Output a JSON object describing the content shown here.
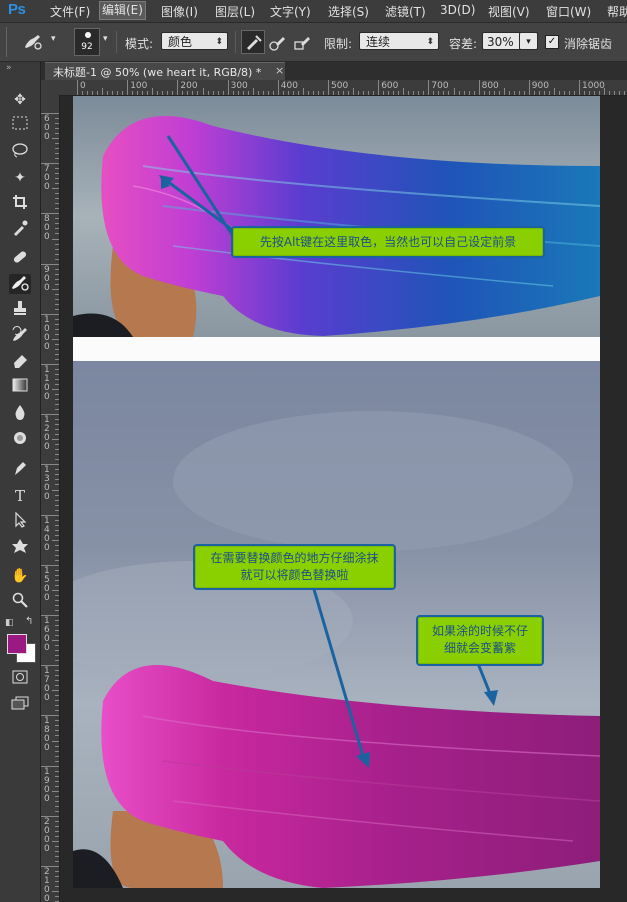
{
  "app": {
    "logo": "Ps"
  },
  "menu": [
    "文件(F)",
    "编辑(E)",
    "图像(I)",
    "图层(L)",
    "文字(Y)",
    "选择(S)",
    "滤镜(T)",
    "3D(D)",
    "视图(V)",
    "窗口(W)",
    "帮助"
  ],
  "options": {
    "brush_size": "92",
    "mode_label": "模式:",
    "mode_value": "颜色",
    "limit_label": "限制:",
    "limit_value": "连续",
    "tolerance_label": "容差:",
    "tolerance_value": "30%",
    "antialias_label": "消除锯齿",
    "antialias_checked": true
  },
  "document_tab": {
    "title": "未标题-1 @ 50% (we heart it, RGB/8) *",
    "close": "×"
  },
  "ruler": {
    "h_labels": [
      "0",
      "100",
      "200",
      "300",
      "400",
      "500",
      "600",
      "700",
      "800",
      "900",
      "1000"
    ],
    "v_labels": [
      "6 0 0",
      "7 0 0",
      "8 0 0",
      "9 0 0",
      "1 0 0 0",
      "1 1 0 0",
      "1 2 0 0",
      "1 3 0 0",
      "1 4 0 0",
      "1 5 0 0",
      "1 6 0 0",
      "1 7 0 0",
      "1 8 0 0",
      "1 9 0 0",
      "2 0 0 0",
      "2 1 0 0"
    ]
  },
  "colors": {
    "foreground": "#9b1a82",
    "background": "#ffffff",
    "callout_fill": "#8ad000",
    "callout_border": "#1b63a0",
    "arrow": "#1b63a0"
  },
  "annotations": {
    "callout1": "先按Alt键在这里取色，当然也可以自己设定前景",
    "callout2_line1": "在需要替换颜色的地方仔细涂抹",
    "callout2_line2": "就可以将颜色替换啦",
    "callout3_line1": "如果涂的时候不仔",
    "callout3_line2": "细就会变蓄紫"
  },
  "tools": [
    "move-tool-icon",
    "marquee-tool-icon",
    "lasso-tool-icon",
    "magic-wand-icon",
    "crop-tool-icon",
    "eyedropper-icon",
    "healing-brush-icon",
    "color-replacement-brush-icon",
    "clone-stamp-icon",
    "history-brush-icon",
    "eraser-icon",
    "gradient-tool-icon",
    "blur-tool-icon",
    "dodge-tool-icon",
    "pen-tool-icon",
    "type-tool-icon",
    "path-selection-icon",
    "custom-shape-icon",
    "hand-tool-icon",
    "zoom-tool-icon"
  ]
}
